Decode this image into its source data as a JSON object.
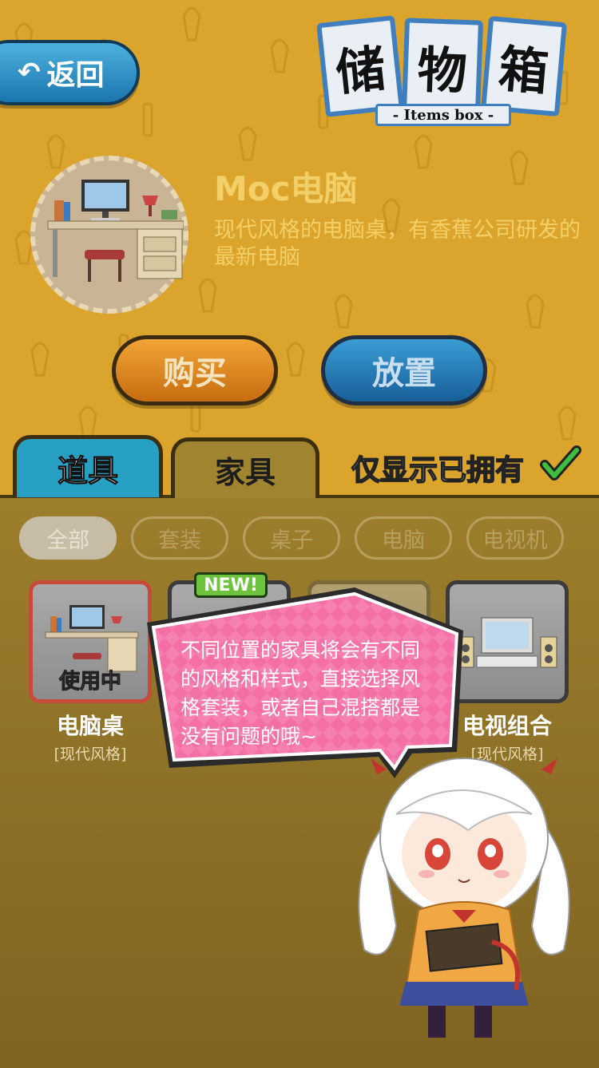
{
  "header": {
    "back_label": "返回",
    "title_chars": [
      "储",
      "物",
      "箱"
    ],
    "title_sub": "- Items box -"
  },
  "selected_item": {
    "name": "Moc电脑",
    "description": "现代风格的电脑桌，有香蕉公司研发的最新电脑"
  },
  "actions": {
    "buy_label": "购买",
    "place_label": "放置"
  },
  "tabs": {
    "tools_label": "道具",
    "furniture_label": "家具",
    "owned_only_label": "仅显示已拥有"
  },
  "filters": [
    "全部",
    "套装",
    "桌子",
    "电脑",
    "电视机"
  ],
  "items": [
    {
      "name": "电脑桌",
      "style": "[现代风格]",
      "status": "使用中"
    },
    {
      "badge": "NEW!"
    },
    {},
    {
      "name": "电视组合",
      "style": "[现代风格]"
    }
  ],
  "tooltip": {
    "text": "不同位置的家具将会有不同的风格和样式，直接选择风格套装，或者自己混搭都是没有问题的哦~"
  },
  "colors": {
    "top_bg": "#dba52d",
    "bottom_bg": "#8a6f25",
    "buy_orange": "#e38a1f",
    "place_blue": "#2a7fba",
    "bubble_pink": "#f46fa5"
  }
}
